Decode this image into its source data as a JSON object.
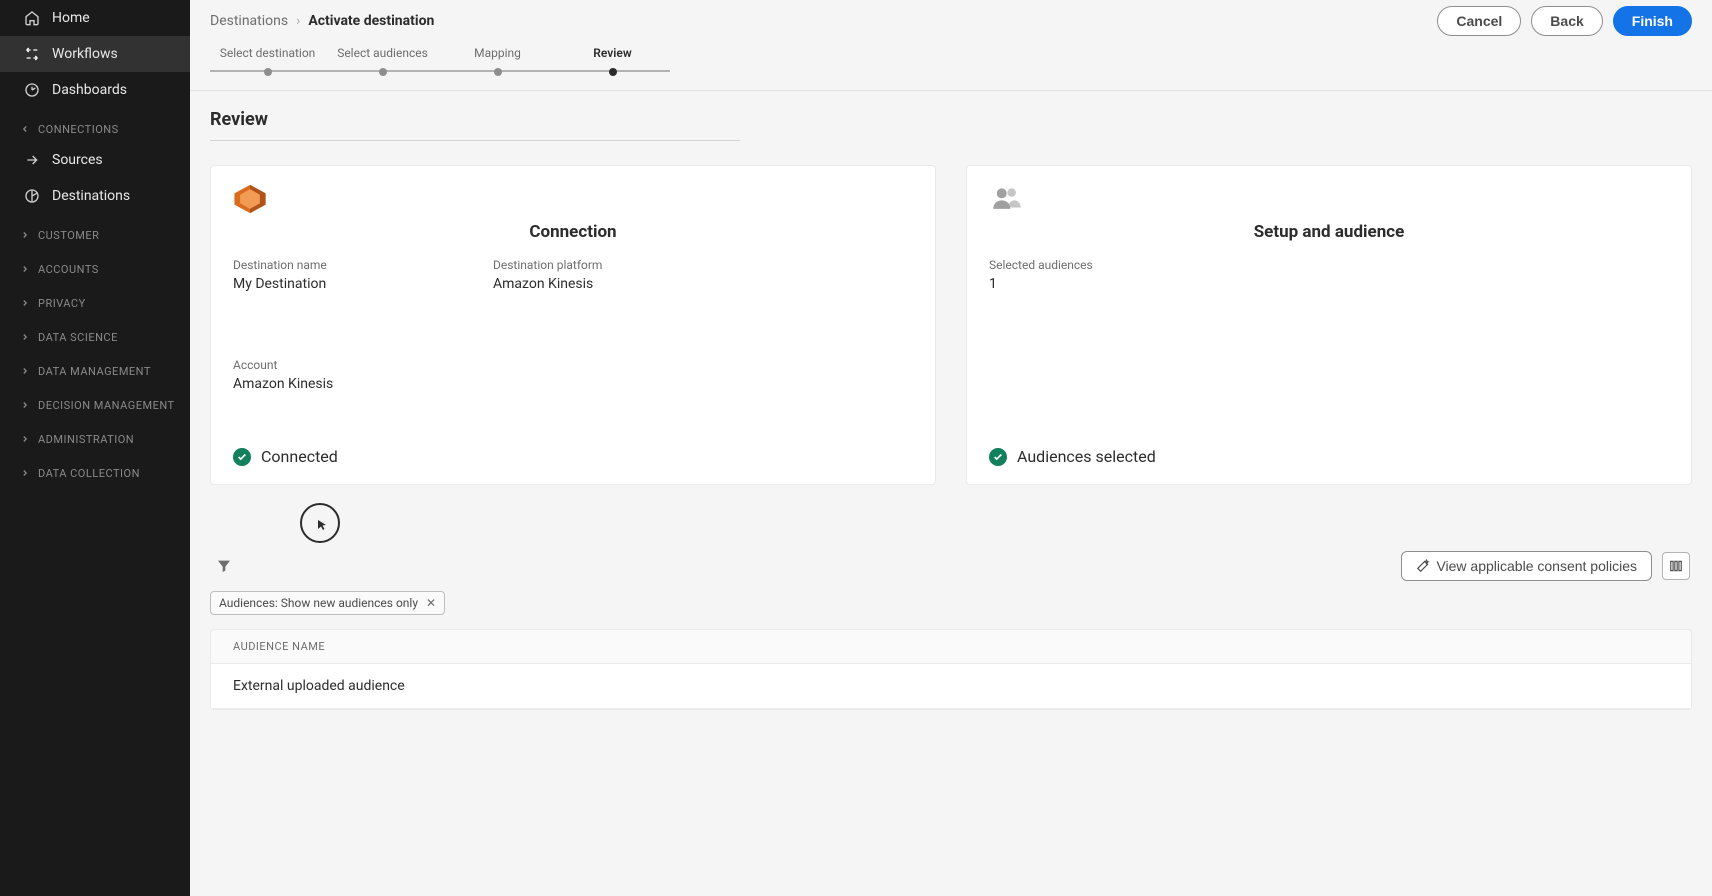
{
  "sidebar": {
    "home": "Home",
    "workflows": "Workflows",
    "dashboards": "Dashboards",
    "groups": {
      "connections": {
        "label": "CONNECTIONS",
        "sources": "Sources",
        "destinations": "Destinations"
      },
      "customer": "CUSTOMER",
      "accounts": "ACCOUNTS",
      "privacy": "PRIVACY",
      "datascience": "DATA SCIENCE",
      "datamgmt": "DATA MANAGEMENT",
      "decision": "DECISION MANAGEMENT",
      "admin": "ADMINISTRATION",
      "datacoll": "DATA COLLECTION"
    }
  },
  "breadcrumb": {
    "root": "Destinations",
    "current": "Activate destination"
  },
  "actions": {
    "cancel": "Cancel",
    "back": "Back",
    "finish": "Finish"
  },
  "stepper": {
    "steps": [
      "Select destination",
      "Select audiences",
      "Mapping",
      "Review"
    ],
    "active_index": 3
  },
  "section_title": "Review",
  "connection_card": {
    "title": "Connection",
    "fields": {
      "destination_name_label": "Destination name",
      "destination_name_value": "My Destination",
      "destination_platform_label": "Destination platform",
      "destination_platform_value": "Amazon Kinesis",
      "account_label": "Account",
      "account_value": "Amazon Kinesis"
    },
    "status": "Connected"
  },
  "audience_card": {
    "title": "Setup and audience",
    "selected_label": "Selected audiences",
    "selected_value": "1",
    "status": "Audiences selected"
  },
  "toolbar": {
    "consent_button": "View applicable consent policies",
    "filter_chip": "Audiences: Show new audiences only"
  },
  "table": {
    "header": "AUDIENCE NAME",
    "rows": [
      "External uploaded audience"
    ]
  }
}
